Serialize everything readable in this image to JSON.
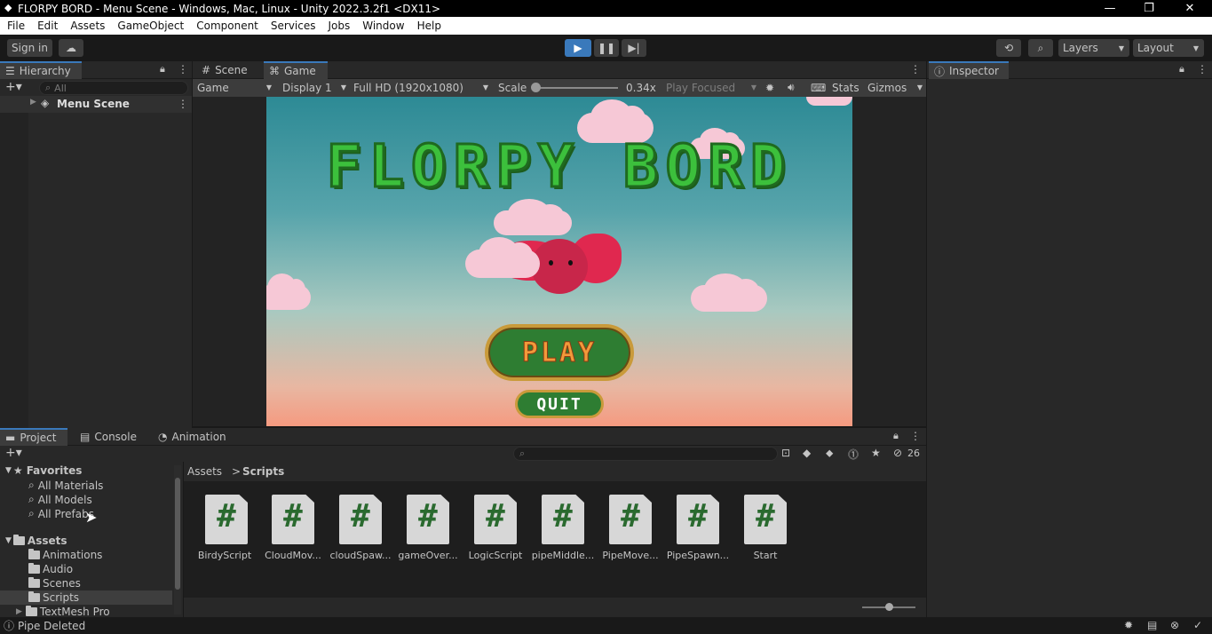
{
  "window": {
    "title": "FLORPY BORD - Menu Scene - Windows, Mac, Linux - Unity 2022.3.2f1 <DX11>"
  },
  "menu": [
    "File",
    "Edit",
    "Assets",
    "GameObject",
    "Component",
    "Services",
    "Jobs",
    "Window",
    "Help"
  ],
  "toolbar": {
    "sign_in": "Sign in",
    "layers": "Layers",
    "layout": "Layout"
  },
  "hierarchy": {
    "tab": "Hierarchy",
    "search_placeholder": "All",
    "scene": "Menu Scene"
  },
  "scene_tabs": {
    "scene": "Scene",
    "game": "Game"
  },
  "game_toolbar": {
    "mode": "Game",
    "display": "Display 1",
    "resolution": "Full HD (1920x1080)",
    "scale_label": "Scale",
    "scale_value": "0.34x",
    "play_focused": "Play Focused",
    "stats": "Stats",
    "gizmos": "Gizmos"
  },
  "game_view": {
    "title": "FLORPY BORD",
    "play": "PLAY",
    "quit": "QUIT"
  },
  "inspector": {
    "tab": "Inspector"
  },
  "bottom_tabs": {
    "project": "Project",
    "console": "Console",
    "animation": "Animation"
  },
  "project": {
    "favorites_label": "Favorites",
    "favorites": [
      "All Materials",
      "All Models",
      "All Prefabs"
    ],
    "assets_label": "Assets",
    "folders": [
      "Animations",
      "Audio",
      "Scenes",
      "Scripts",
      "TextMesh Pro"
    ],
    "selected_folder": "Scripts",
    "breadcrumb_root": "Assets",
    "breadcrumb_current": "Scripts",
    "hidden_count": "26",
    "scripts": [
      "BirdyScript",
      "CloudMov...",
      "cloudSpaw...",
      "gameOver...",
      "LogicScript",
      "pipeMiddle...",
      "PipeMove...",
      "PipeSpawn...",
      "Start"
    ]
  },
  "status": {
    "message": "Pipe Deleted"
  },
  "colors": {
    "accent": "#3a79bb",
    "play_button": "#2e7d32",
    "title_green": "#3cc03c",
    "cloud": "#f6c8d6",
    "bird": "#e0284f"
  }
}
